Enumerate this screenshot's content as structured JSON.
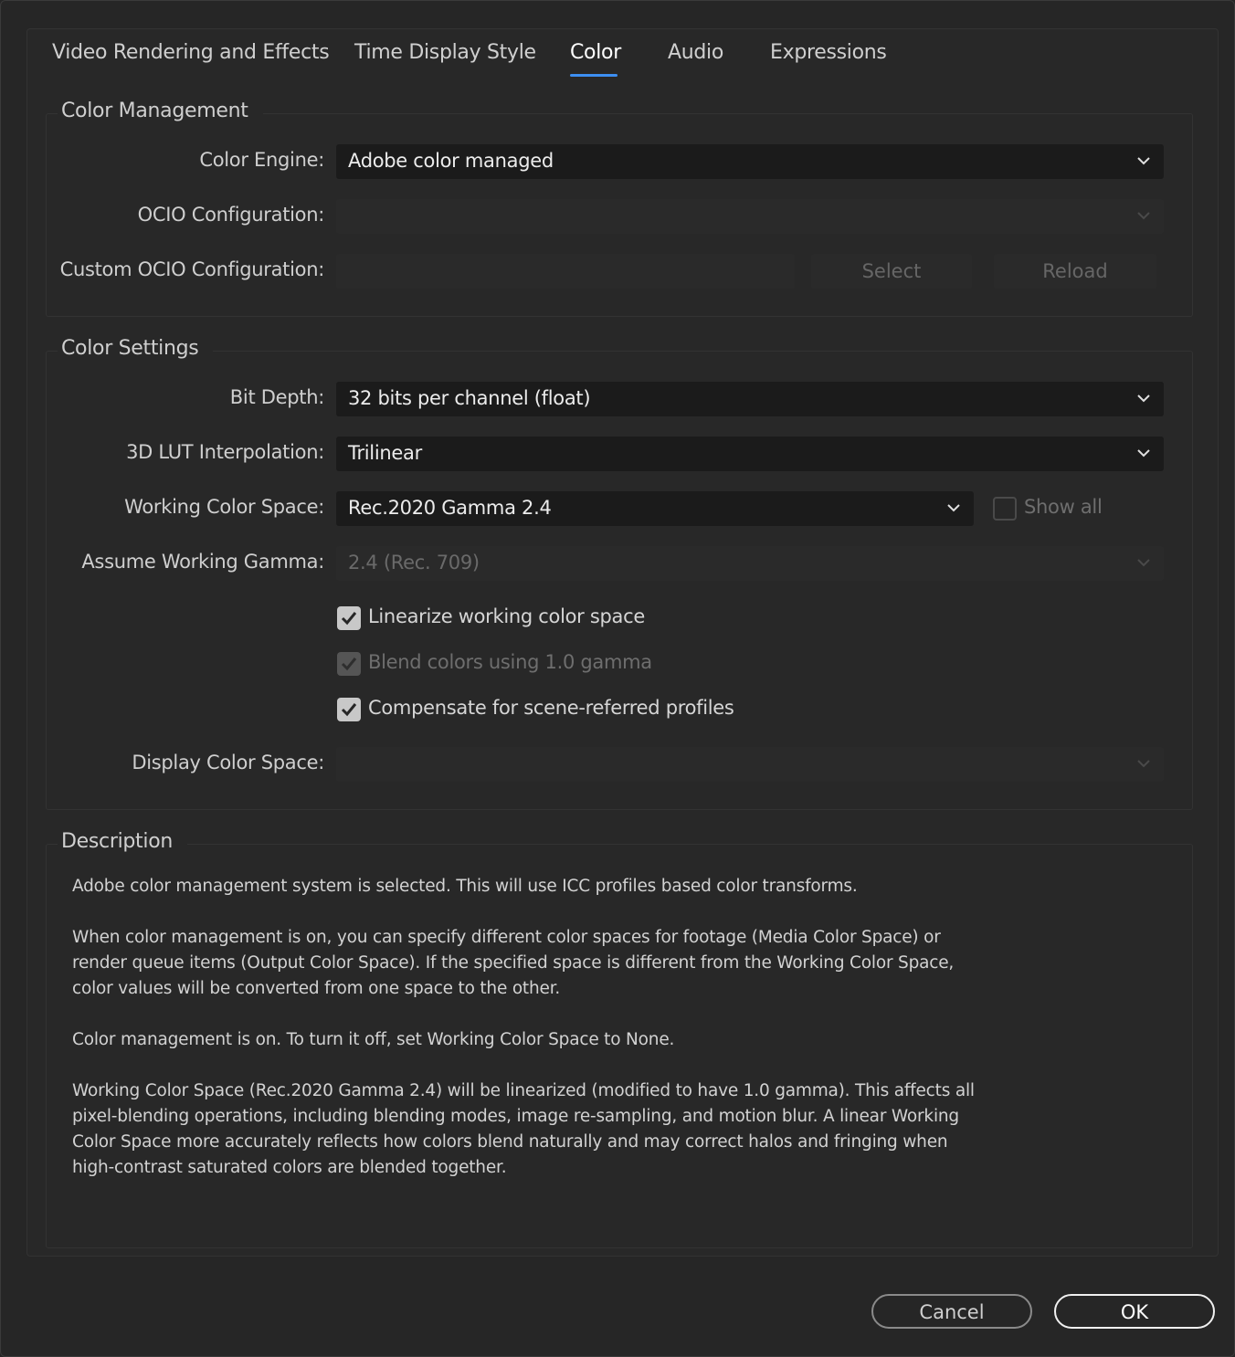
{
  "tabs": [
    {
      "label": "Video Rendering and Effects",
      "active": false
    },
    {
      "label": "Time Display Style",
      "active": false
    },
    {
      "label": "Color",
      "active": true
    },
    {
      "label": "Audio",
      "active": false
    },
    {
      "label": "Expressions",
      "active": false
    }
  ],
  "colors": {
    "accent": "#3d8ff2",
    "background": "#262626",
    "field": "#1b1b1b"
  },
  "color_management": {
    "title": "Color Management",
    "color_engine_label": "Color Engine:",
    "color_engine_value": "Adobe color managed",
    "ocio_config_label": "OCIO Configuration:",
    "custom_ocio_label": "Custom OCIO Configuration:",
    "select_label": "Select",
    "reload_label": "Reload"
  },
  "color_settings": {
    "title": "Color Settings",
    "bit_depth_label": "Bit Depth:",
    "bit_depth_value": "32 bits per channel (float)",
    "lut_label": "3D LUT Interpolation:",
    "lut_value": "Trilinear",
    "working_space_label": "Working Color Space:",
    "working_space_value": "Rec.2020 Gamma 2.4",
    "show_all_label": "Show all",
    "show_all_checked": false,
    "assume_gamma_label": "Assume Working Gamma:",
    "assume_gamma_value": "2.4 (Rec. 709)",
    "linearize_label": "Linearize working color space",
    "linearize_checked": true,
    "blend_label": "Blend colors using 1.0 gamma",
    "blend_checked": true,
    "compensate_label": "Compensate for scene-referred profiles",
    "compensate_checked": true,
    "display_space_label": "Display Color Space:"
  },
  "description": {
    "title": "Description",
    "p1": "Adobe color management system is selected. This will use ICC profiles based color transforms.",
    "p2": "When color management is on, you can specify different color spaces for footage (Media Color Space) or render queue items (Output Color Space). If the specified space is different from the Working Color Space, color values will be converted from one space to the other.",
    "p3": "Color management is on. To turn it off, set Working Color Space to None.",
    "p4": "Working Color Space (Rec.2020 Gamma 2.4) will be linearized (modified to have 1.0 gamma). This affects all pixel-blending operations, including blending modes, image re-sampling, and motion blur. A linear Working Color Space more accurately reflects how colors blend naturally and may correct halos and fringing when high-contrast saturated colors are blended together."
  },
  "footer": {
    "cancel_label": "Cancel",
    "ok_label": "OK"
  }
}
